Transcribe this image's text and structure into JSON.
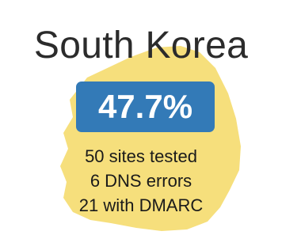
{
  "country": {
    "name": "South Korea",
    "score": "47.7%"
  },
  "stats": [
    "50 sites tested",
    "6 DNS errors",
    "21 with DMARC"
  ],
  "colors": {
    "map_fill": "#f6df7c",
    "badge": "#337ab7",
    "badge_text": "#ffffff",
    "title_text": "#2b2b2b",
    "stat_text": "#1a1a1a"
  },
  "icons": {
    "map": "south-korea-map-silhouette"
  }
}
